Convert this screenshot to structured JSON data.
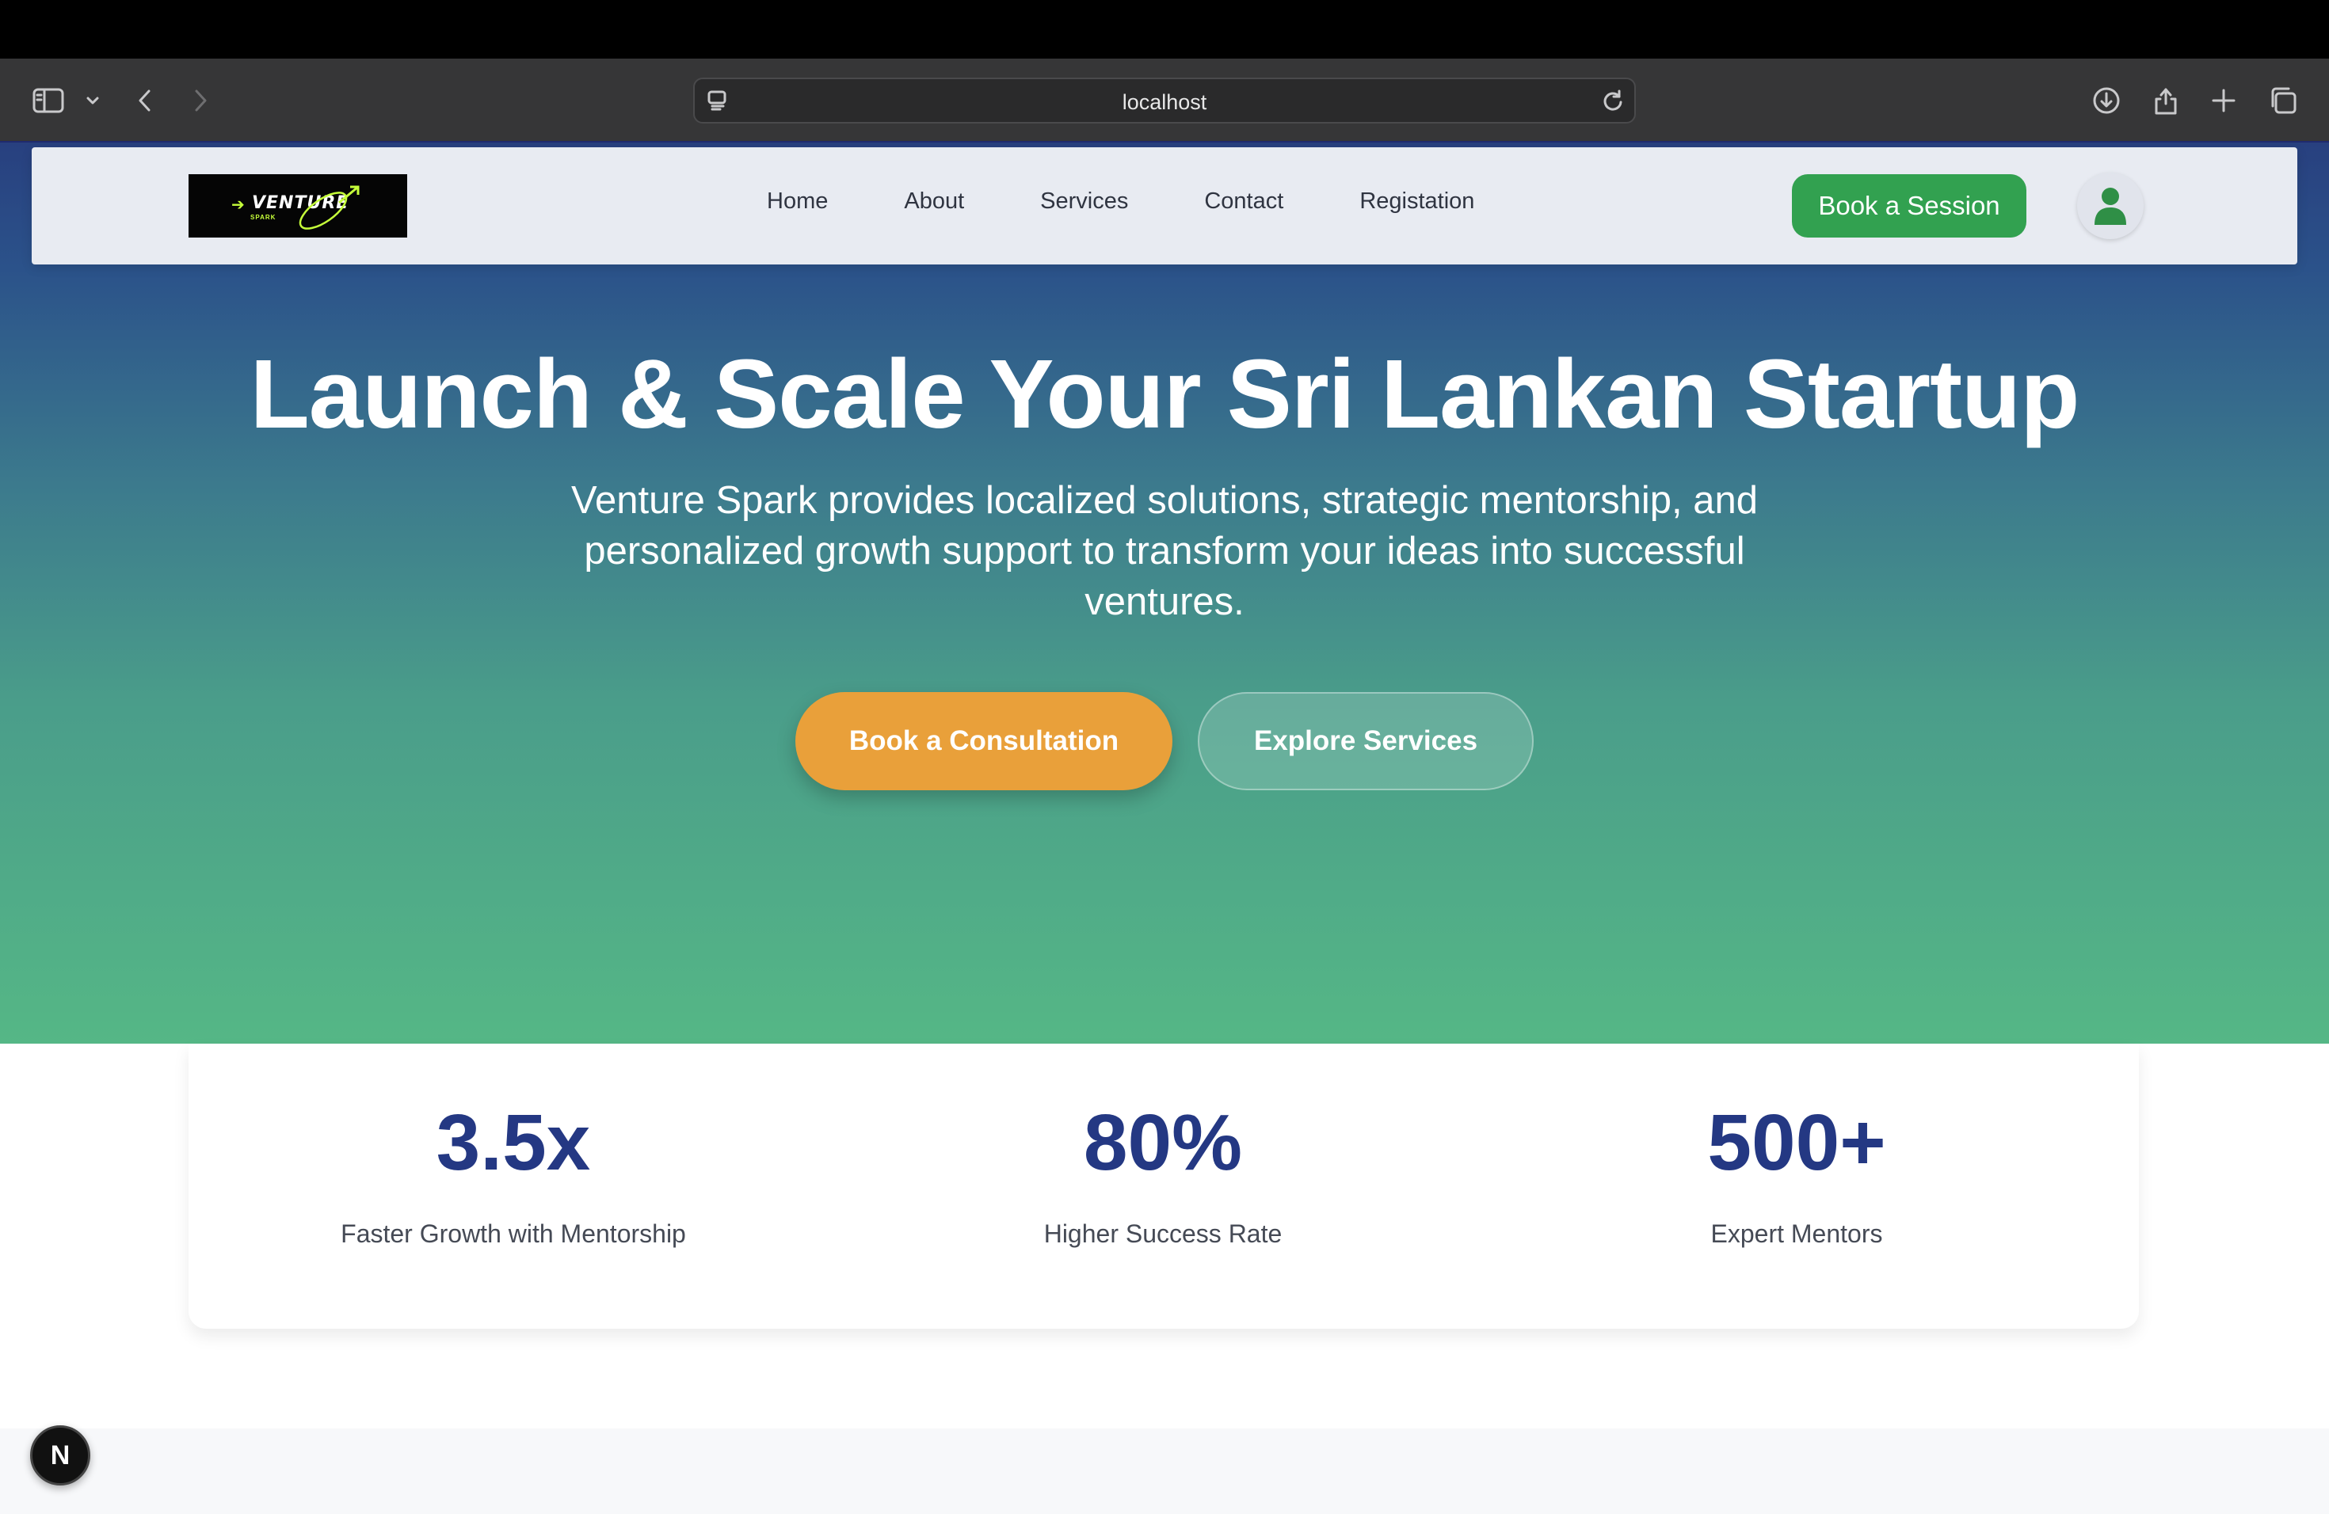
{
  "browser": {
    "url": "localhost",
    "icons": [
      "sidebar-icon",
      "chevron-down-icon",
      "back-icon",
      "forward-icon",
      "page-menu-icon",
      "reload-icon",
      "download-icon",
      "share-icon",
      "new-tab-icon",
      "tabs-overview-icon"
    ]
  },
  "nav": {
    "logo": {
      "word": "VENTURE",
      "sub": "SPARK",
      "arrow": "➔"
    },
    "links": [
      "Home",
      "About",
      "Services",
      "Contact",
      "Registation"
    ],
    "cta": "Book a Session",
    "user_icon": "user-icon"
  },
  "hero": {
    "title": "Launch & Scale Your Sri Lankan Startup",
    "subtitle": "Venture Spark provides localized solutions, strategic mentorship, and personalized growth support to transform your ideas into successful ventures.",
    "primary_button": "Book a Consultation",
    "secondary_button": "Explore Services"
  },
  "stats": [
    {
      "value": "3.5x",
      "label": "Faster Growth with Mentorship"
    },
    {
      "value": "80%",
      "label": "Higher Success Rate"
    },
    {
      "value": "500+",
      "label": "Expert Mentors"
    }
  ],
  "dev_badge": "N",
  "colors": {
    "brand_navy": "#243883",
    "cta_green": "#32a150",
    "accent_orange": "#e9a03a",
    "hero_gradient_top": "#28407f",
    "hero_gradient_bottom": "#55b786"
  }
}
